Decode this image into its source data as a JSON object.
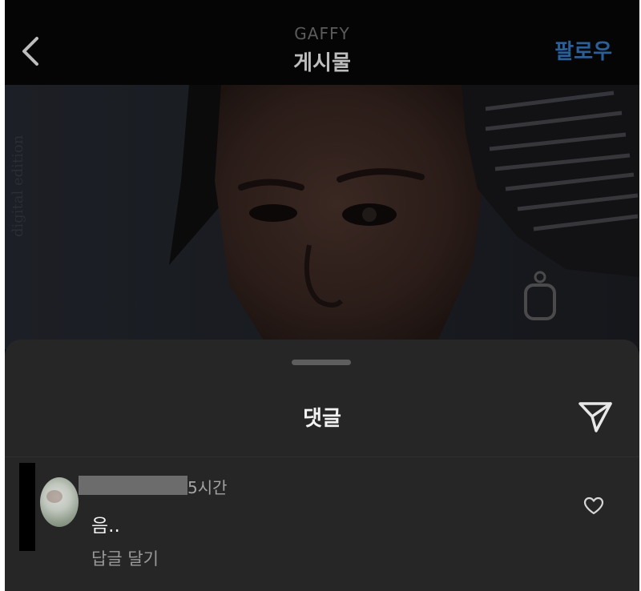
{
  "header": {
    "account_name": "GAFFY",
    "title": "게시물",
    "follow_label": "팔로우"
  },
  "post": {
    "watermark_text": "digital edition"
  },
  "comments_sheet": {
    "title": "댓글",
    "comments": [
      {
        "time": "5시간",
        "text": "음..",
        "reply_label": "답글 달기"
      }
    ]
  },
  "icons": {
    "back": "chevron-left-icon",
    "send": "paper-plane-icon",
    "like": "heart-outline-icon"
  },
  "colors": {
    "header_bg": "#050505",
    "follow_accent": "#2b5f96",
    "sheet_bg": "#262626",
    "secondary_text": "#9a9a9a"
  }
}
